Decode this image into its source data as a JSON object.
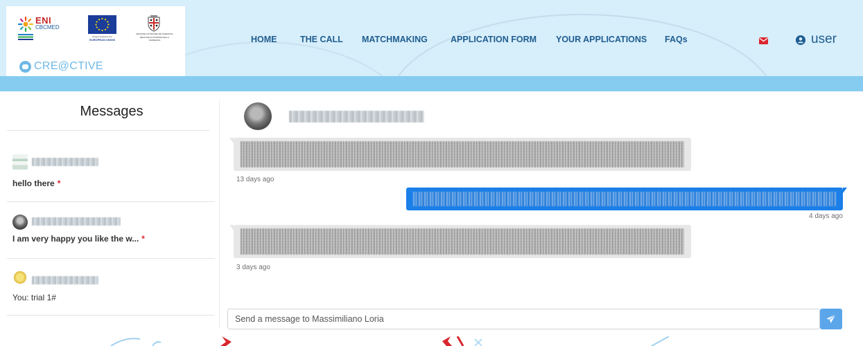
{
  "header": {
    "eni": {
      "title": "ENI",
      "subtitle": "CBCMED"
    },
    "eu": {
      "caption": "Project funded by the",
      "name": "EUROPEAN UNION"
    },
    "sardinia": {
      "caption": "REGIONE AUTÒNOMA DE SARDIGNA",
      "caption2": "REGIONE AUTONOMA DELLA SARDEGNA"
    },
    "brand": "CRE@CTIVE",
    "nav": [
      {
        "label": "HOME"
      },
      {
        "label": "THE CALL"
      },
      {
        "label": "MATCHMAKING"
      },
      {
        "label": "APPLICATION FORM"
      },
      {
        "label": "YOUR APPLICATIONS"
      },
      {
        "label": "FAQs"
      }
    ],
    "user_label": "user",
    "colors": {
      "nav_text": "#1f5d8f",
      "header_bg": "#d7eefb",
      "band": "#86ccf0",
      "mail_icon": "#d9262e"
    }
  },
  "sidebar": {
    "title": "Messages",
    "conversations": [
      {
        "preview": "hello there",
        "unread": true,
        "unread_mark": "*",
        "avatar_icon": "document-thumbnail-icon"
      },
      {
        "preview": "I am very happy you like the w...",
        "unread": true,
        "unread_mark": "*",
        "avatar_icon": "photo-avatar"
      },
      {
        "preview": "You: trial 1#",
        "unread": false,
        "avatar_icon": "logo-avatar"
      }
    ]
  },
  "chat": {
    "messages": [
      {
        "direction": "incoming",
        "time": "13 days ago"
      },
      {
        "direction": "outgoing",
        "time": "4 days ago"
      },
      {
        "direction": "incoming",
        "time": "3 days ago"
      }
    ],
    "composer": {
      "placeholder": "Send a message to Massimiliano Loria"
    },
    "colors": {
      "outgoing_bubble": "#1a7fe8",
      "incoming_bubble": "#e7e7e7",
      "send_button": "#5ba6ea"
    }
  }
}
